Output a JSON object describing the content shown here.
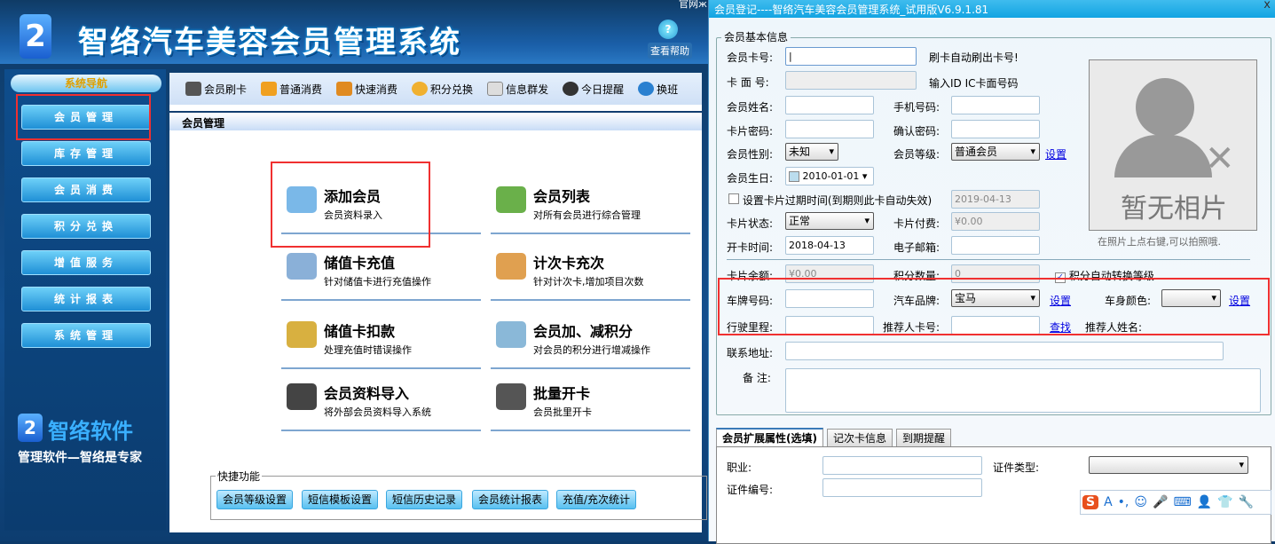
{
  "app": {
    "title": "智络汽车美容会员管理系统",
    "top_right_text": "官网ж",
    "help": "查看帮助"
  },
  "sidebar": {
    "title": "系统导航",
    "items": [
      "会员管理",
      "库存管理",
      "会员消费",
      "积分兑换",
      "增值服务",
      "统计报表",
      "系统管理"
    ],
    "brand_name": "智络软件",
    "brand_slogan": "管理软件—智络是专家"
  },
  "toolbar": {
    "items": [
      "会员刷卡",
      "普通消费",
      "快速消费",
      "积分兑换",
      "信息群发",
      "今日提醒",
      "换班"
    ]
  },
  "main": {
    "title": "会员管理",
    "menu": [
      {
        "title": "添加会员",
        "desc": "会员资料录入"
      },
      {
        "title": "会员列表",
        "desc": "对所有会员进行综合管理"
      },
      {
        "title": "储值卡充值",
        "desc": "针对储值卡进行充值操作"
      },
      {
        "title": "计次卡充次",
        "desc": "针对计次卡,增加项目次数"
      },
      {
        "title": "储值卡扣款",
        "desc": "处理充值时错误操作"
      },
      {
        "title": "会员加、减积分",
        "desc": "对会员的积分进行增减操作"
      },
      {
        "title": "会员资料导入",
        "desc": "将外部会员资料导入系统"
      },
      {
        "title": "批量开卡",
        "desc": "会员批里开卡"
      }
    ],
    "quick_label": "快捷功能",
    "quick_buttons": [
      "会员等级设置",
      "短信模板设置",
      "短信历史记录",
      "会员统计报表",
      "充值/充次统计"
    ]
  },
  "dialog": {
    "title": "会员登记----智络汽车美容会员管理系统_试用版V6.9.1.81",
    "close": "x",
    "group": "会员基本信息",
    "card_no": {
      "label": "会员卡号:",
      "value": "|",
      "hint": "刷卡自动刷出卡号!"
    },
    "face_no": {
      "label": "卡 面 号:",
      "hint": "输入ID IC卡面号码"
    },
    "name": {
      "label": "会员姓名:",
      "value": ""
    },
    "mobile": {
      "label": "手机号码:",
      "value": ""
    },
    "password": {
      "label": "卡片密码:",
      "value": ""
    },
    "confirm": {
      "label": "确认密码:",
      "value": ""
    },
    "gender": {
      "label": "会员性别:",
      "value": "未知"
    },
    "level": {
      "label": "会员等级:",
      "value": "普通会员",
      "link": "设置"
    },
    "birthday": {
      "label": "会员生日:",
      "value": "2010-01-01"
    },
    "expire": {
      "label": "设置卡片过期时间(到期则此卡自动失效)",
      "checked": false,
      "value": "2019-04-13"
    },
    "status": {
      "label": "卡片状态:",
      "value": "正常"
    },
    "fee": {
      "label": "卡片付费:",
      "value": "¥0.00"
    },
    "open_date": {
      "label": "开卡时间:",
      "value": "2018-04-13"
    },
    "email": {
      "label": "电子邮箱:",
      "value": ""
    },
    "balance": {
      "label": "卡片余额:",
      "value": "¥0.00"
    },
    "points": {
      "label": "积分数量:",
      "value": "0"
    },
    "auto_level": {
      "label": "积分自动转换等级",
      "checked": true
    },
    "plate": {
      "label": "车牌号码:",
      "value": ""
    },
    "brand": {
      "label": "汽车品牌:",
      "value": "宝马",
      "link": "设置"
    },
    "color": {
      "label": "车身颜色:",
      "value": "",
      "link": "设置"
    },
    "mileage": {
      "label": "行驶里程:",
      "value": ""
    },
    "referrer_no": {
      "label": "推荐人卡号:",
      "value": "",
      "link": "查找"
    },
    "referrer_name": {
      "label": "推荐人姓名:"
    },
    "address": {
      "label": "联系地址:",
      "value": ""
    },
    "note": {
      "label": "备 注:",
      "value": ""
    },
    "photo": {
      "text": "暂无相片",
      "hint": "在照片上点右键,可以拍照哦."
    },
    "tabs": [
      "会员扩展属性(选填)",
      "记次卡信息",
      "到期提醒"
    ],
    "job": {
      "label": "职业:",
      "value": ""
    },
    "id_type": {
      "label": "证件类型:",
      "value": ""
    },
    "id_no": {
      "label": "证件编号:",
      "value": ""
    },
    "ime": [
      "S",
      "A",
      "•,",
      "☺",
      "🎤",
      "⌨",
      "👤",
      "👕",
      "🔧"
    ]
  }
}
